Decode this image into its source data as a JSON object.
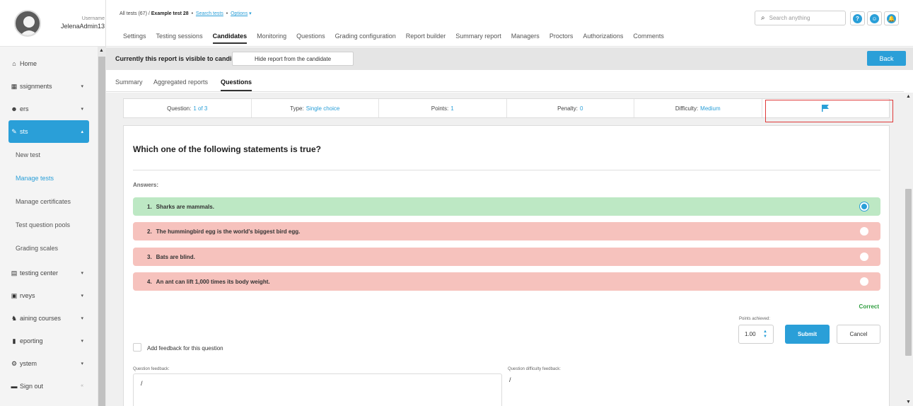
{
  "user": {
    "label": "Username",
    "name": "JelenaAdmin13"
  },
  "sidebar": {
    "items": [
      {
        "label": "Home",
        "icon": "home-icon"
      },
      {
        "label": "ssignments",
        "icon": "assignments-icon"
      },
      {
        "label": "ers",
        "icon": "users-icon"
      },
      {
        "label": "sts",
        "icon": "tests-icon"
      }
    ],
    "sub": [
      "New test",
      "Manage tests",
      "Manage certificates",
      "Test question pools",
      "Grading scales"
    ],
    "items2": [
      {
        "label": "testing center",
        "icon": "testing-center-icon"
      },
      {
        "label": "rveys",
        "icon": "surveys-icon"
      },
      {
        "label": "aining courses",
        "icon": "training-icon"
      },
      {
        "label": "eporting",
        "icon": "reporting-icon"
      },
      {
        "label": "ystem",
        "icon": "system-icon"
      },
      {
        "label": "Sign out",
        "icon": "sign-out-icon"
      }
    ],
    "collapse": "«"
  },
  "breadcrumb": {
    "all_tests": "All tests (67)",
    "sep": "/",
    "test": "Example test 28",
    "dot": "•",
    "search": "Search tests",
    "options": "Options",
    "caret": "▾"
  },
  "tabs": [
    "Settings",
    "Testing sessions",
    "Candidates",
    "Monitoring",
    "Questions",
    "Grading configuration",
    "Report builder",
    "Summary report",
    "Managers",
    "Proctors",
    "Authorizations",
    "Comments"
  ],
  "search": {
    "placeholder": "Search anything"
  },
  "header_buttons": [
    "?",
    "☺",
    "🔔"
  ],
  "visibility": {
    "text": "Currently this report is visible to candidate.",
    "hide_button": "Hide report from the candidate",
    "back_button": "Back"
  },
  "subtabs": [
    "Summary",
    "Aggregated reports",
    "Questions"
  ],
  "info": {
    "question_label": "Question:",
    "question_value": "1 of 3",
    "type_label": "Type:",
    "type_value": "Single choice",
    "points_label": "Points:",
    "points_value": "1",
    "penalty_label": "Penalty:",
    "penalty_value": "0",
    "difficulty_label": "Difficulty:",
    "difficulty_value": "Medium"
  },
  "question": {
    "title": "Which one of the following statements is true?",
    "answers_label": "Answers:",
    "answers": [
      {
        "num": "1.",
        "text": "Sharks are mammals."
      },
      {
        "num": "2.",
        "text": "The hummingbird egg is the world's biggest bird egg."
      },
      {
        "num": "3.",
        "text": "Bats are blind."
      },
      {
        "num": "4.",
        "text": "An ant can lift 1,000 times its body weight."
      }
    ],
    "result": "Correct",
    "points_label": "Points achieved:",
    "points_value": "1.00",
    "submit": "Submit",
    "cancel": "Cancel",
    "feedback_check": "Add feedback for this question",
    "qf_label": "Question feedback:",
    "qf_value": "/",
    "qdf_label": "Question difficulty feedback:",
    "qdf_value": "/"
  },
  "colors": {
    "accent": "#2a9fd8",
    "correct_bg": "#bde8c4",
    "wrong_bg": "#f6c2bd",
    "highlight": "#e03a3a"
  }
}
